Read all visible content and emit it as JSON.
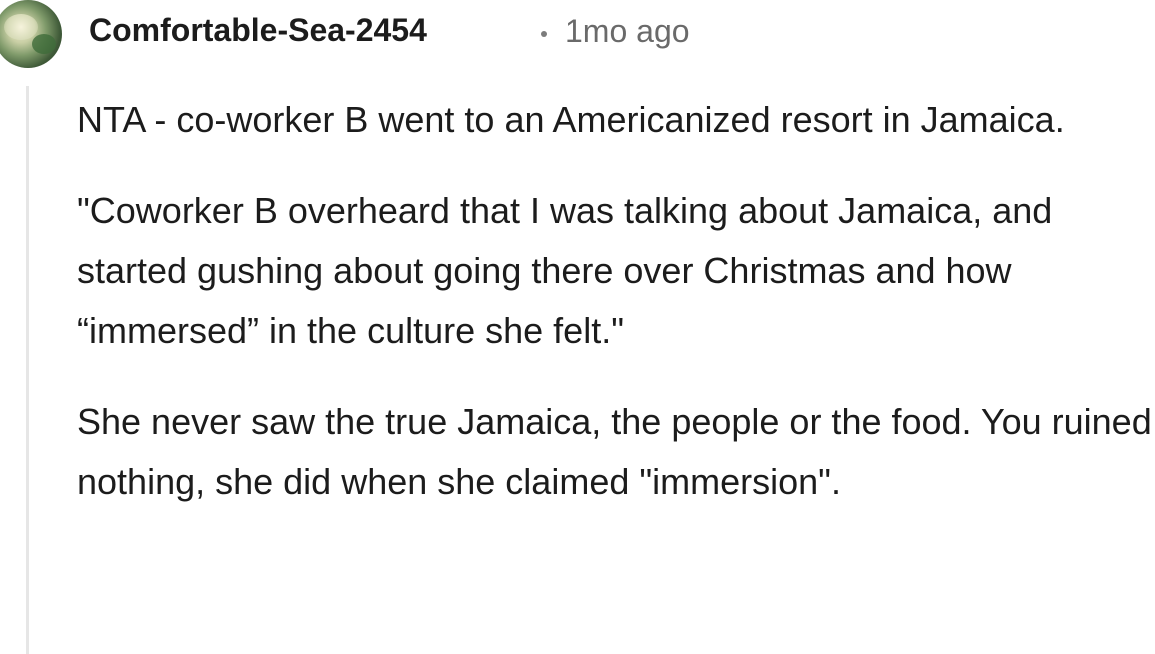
{
  "comment": {
    "author": "Comfortable-Sea-2454",
    "separator": "•",
    "timestamp": "1mo ago",
    "avatar_icon": "user-avatar-icon",
    "paragraphs": [
      "NTA - co-worker B went to an Americanized resort in Jamaica.",
      "\"Coworker B overheard that I was talking about Jamaica, and started gushing about going there over Christmas and how “immersed” in the culture she felt.\"",
      "She never saw the true Jamaica, the people or the food. You ruined nothing, she did when she claimed \"immersion\"."
    ]
  }
}
